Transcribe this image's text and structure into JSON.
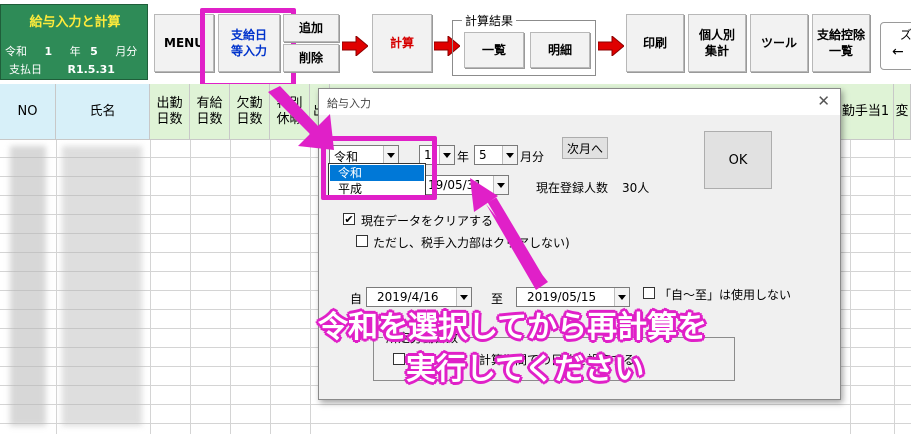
{
  "info_box": {
    "title": "給与入力と計算",
    "era_label": "令和",
    "year": "1",
    "year_unit": "年",
    "month": "5",
    "month_unit": "月分",
    "pay_date_label": "支払日",
    "pay_date_value": "R1.5.31"
  },
  "toolbar": {
    "menu": "MENU",
    "pay_date_input": "支給日\n等入力",
    "add": "追加",
    "delete": "削除",
    "calc": "計算",
    "results_group": "計算結果",
    "list": "一覧",
    "detail": "明細",
    "print": "印刷",
    "individual_total": "個人別\n集計",
    "tools": "ツール",
    "deduction_list": "支給控除\n一覧",
    "cut_label": "ズ"
  },
  "sheet": {
    "headers": [
      "NO",
      "氏名",
      "出勤\n日数",
      "有給\n日数",
      "欠勤\n日数",
      "特別\n休暇",
      "出"
    ],
    "right_headers": [
      "勤手当1",
      "変"
    ]
  },
  "dialog": {
    "title": "給与入力",
    "era_value": "令和",
    "year_value": "1",
    "year_unit": "年",
    "month_value": "5",
    "month_unit": "月分",
    "next_month_button": "次月へ",
    "ok_button": "OK",
    "pay_date_value": "19/05/31",
    "registered_label": "現在登録人数",
    "registered_count": "30人",
    "clear_data_label": "現在データをクリアする",
    "tax_input_label": "ただし、税手入力部はクリアしない)",
    "from_label": "自",
    "from_date": "2019/4/16",
    "to_label": "至",
    "to_date": "2019/05/15",
    "no_range_label": "「自～至」は使用しない",
    "workdays_group": "所定労働日数",
    "workdays_text": "計算期間での日数を設定する",
    "era_options": [
      "令和",
      "平成"
    ],
    "era_selected": "令和"
  },
  "annotation": {
    "line1": "令和を選択してから再計算を",
    "line2": "実行してください",
    "color": "#e020c8"
  }
}
